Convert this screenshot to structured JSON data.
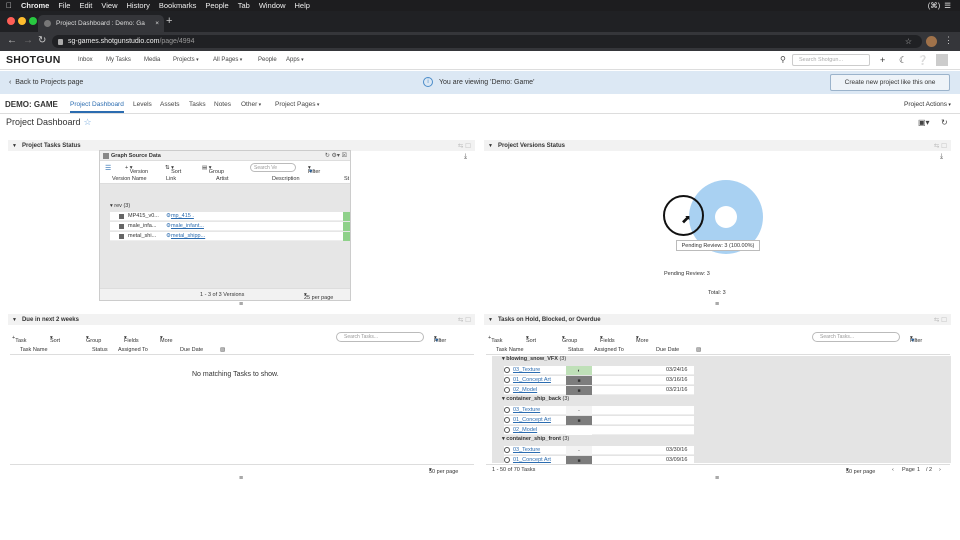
{
  "mac_menu": {
    "apple": "",
    "app": "Chrome",
    "items": [
      "File",
      "Edit",
      "View",
      "History",
      "Bookmarks",
      "People",
      "Tab",
      "Window",
      "Help"
    ],
    "right": "(⌘)"
  },
  "browser": {
    "tab_title": "Project Dashboard : Demo: Ga",
    "url_host": "sg-games.shotgunstudio.com",
    "url_path": "/page/4994"
  },
  "sg_nav": {
    "logo": "SHOTGUN",
    "items": [
      "Inbox",
      "My Tasks",
      "Media",
      "Projects",
      "All Pages",
      "People",
      "Apps"
    ],
    "search_placeholder": "Search Shotgun..."
  },
  "banner": {
    "back": "Back to Projects page",
    "viewing": "You are viewing 'Demo: Game'",
    "create": "Create new project like this one"
  },
  "project": {
    "name": "DEMO: GAME",
    "tabs": [
      "Project Dashboard",
      "Levels",
      "Assets",
      "Tasks",
      "Notes",
      "Other",
      "Project Pages"
    ],
    "actions": "Project Actions"
  },
  "page_title": "Project Dashboard",
  "panels": {
    "tasks_status": "Project Tasks Status",
    "versions_status": "Project Versions Status",
    "due": "Due in next 2 weeks",
    "hold": "Tasks on Hold, Blocked, or Overdue"
  },
  "gsd": {
    "title": "Graph Source Data",
    "tools": [
      "Version",
      "Sort",
      "Group"
    ],
    "search": "Search Ve",
    "filter": "Filter",
    "columns": [
      "Version Name",
      "Link",
      "Artist",
      "Description",
      "St"
    ],
    "group": "rev (3)",
    "rows": [
      {
        "name": "MP415_v0...",
        "link": "mp_415 ."
      },
      {
        "name": "male_infa...",
        "link": "male_infant..."
      },
      {
        "name": "metal_shi...",
        "link": "metal_shipp..."
      }
    ],
    "count": "1 - 3 of 3 Versions",
    "per_page": "25 per page"
  },
  "chart_data": {
    "type": "pie",
    "title": "",
    "categories": [
      "Pending Review"
    ],
    "values": [
      3
    ],
    "tooltip": "Pending Review: 3 (100.00%)",
    "legend": "Pending Review: 3",
    "total": "Total: 3",
    "colors": [
      "#a9d1f2"
    ]
  },
  "task_toolbar": {
    "items": [
      "Task",
      "Sort",
      "Group",
      "Fields",
      "More"
    ],
    "search": "Search Tasks...",
    "filter": "Filter"
  },
  "task_columns": [
    "Task Name",
    "Status",
    "Assigned To",
    "Due Date"
  ],
  "due": {
    "empty": "No matching Tasks to show.",
    "per_page": "50 per page"
  },
  "hold": {
    "groups": [
      {
        "name": "blowing_snow_VFX",
        "count": "(3)",
        "rows": [
          {
            "task": "03_Texture",
            "status": "ip",
            "date": "03/24/16"
          },
          {
            "task": "01_Concept Art",
            "status": "hld",
            "date": "03/16/16"
          },
          {
            "task": "02_Model",
            "status": "hld",
            "date": "03/21/16"
          }
        ]
      },
      {
        "name": "container_ship_back",
        "count": "(3)",
        "rows": [
          {
            "task": "03_Texture",
            "status": "wtg",
            "date": ""
          },
          {
            "task": "01_Concept Art",
            "status": "hld",
            "date": ""
          },
          {
            "task": "02_Model",
            "status": "none",
            "date": ""
          }
        ]
      },
      {
        "name": "container_ship_front",
        "count": "(3)",
        "rows": [
          {
            "task": "03_Texture",
            "status": "wtg",
            "date": "03/30/16"
          },
          {
            "task": "01_Concept Art",
            "status": "hld",
            "date": "03/09/16"
          }
        ]
      }
    ],
    "count": "1 - 50 of 70 Tasks",
    "per_page": "50 per page",
    "page_label": "Page",
    "page_value": "1",
    "page_total": "/ 2"
  }
}
